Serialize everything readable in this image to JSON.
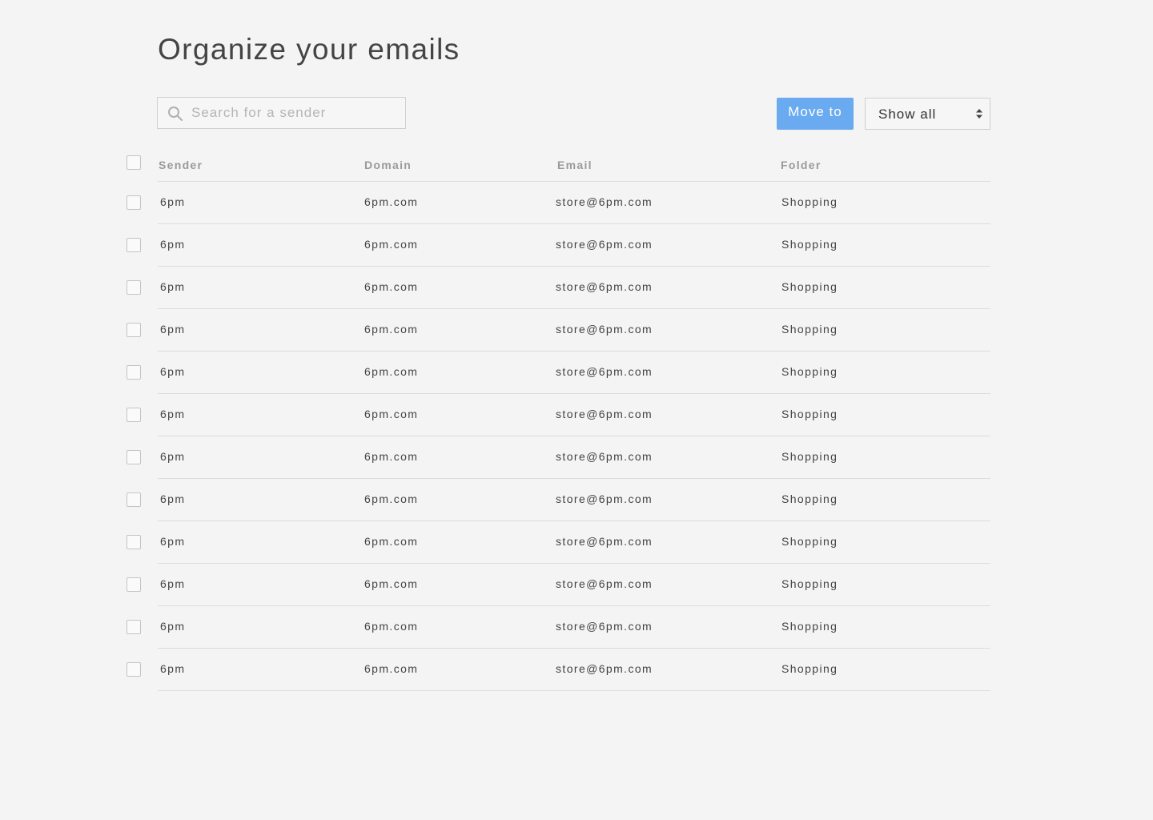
{
  "page": {
    "title": "Organize your emails"
  },
  "toolbar": {
    "search_placeholder": "Search for a sender",
    "search_value": "",
    "move_label": "Move to",
    "filter_value": "Show all",
    "icons": {
      "search": "search-icon",
      "select_arrows": "sort-arrows-icon"
    }
  },
  "colors": {
    "accent": "#6aaaf0",
    "background": "#f4f4f4"
  },
  "table": {
    "columns": [
      "Sender",
      "Domain",
      "Email",
      "Folder"
    ],
    "rows": [
      {
        "sender": "6pm",
        "domain": "6pm.com",
        "email": "store@6pm.com",
        "folder": "Shopping"
      },
      {
        "sender": "6pm",
        "domain": "6pm.com",
        "email": "store@6pm.com",
        "folder": "Shopping"
      },
      {
        "sender": "6pm",
        "domain": "6pm.com",
        "email": "store@6pm.com",
        "folder": "Shopping"
      },
      {
        "sender": "6pm",
        "domain": "6pm.com",
        "email": "store@6pm.com",
        "folder": "Shopping"
      },
      {
        "sender": "6pm",
        "domain": "6pm.com",
        "email": "store@6pm.com",
        "folder": "Shopping"
      },
      {
        "sender": "6pm",
        "domain": "6pm.com",
        "email": "store@6pm.com",
        "folder": "Shopping"
      },
      {
        "sender": "6pm",
        "domain": "6pm.com",
        "email": "store@6pm.com",
        "folder": "Shopping"
      },
      {
        "sender": "6pm",
        "domain": "6pm.com",
        "email": "store@6pm.com",
        "folder": "Shopping"
      },
      {
        "sender": "6pm",
        "domain": "6pm.com",
        "email": "store@6pm.com",
        "folder": "Shopping"
      },
      {
        "sender": "6pm",
        "domain": "6pm.com",
        "email": "store@6pm.com",
        "folder": "Shopping"
      },
      {
        "sender": "6pm",
        "domain": "6pm.com",
        "email": "store@6pm.com",
        "folder": "Shopping"
      },
      {
        "sender": "6pm",
        "domain": "6pm.com",
        "email": "store@6pm.com",
        "folder": "Shopping"
      }
    ]
  }
}
